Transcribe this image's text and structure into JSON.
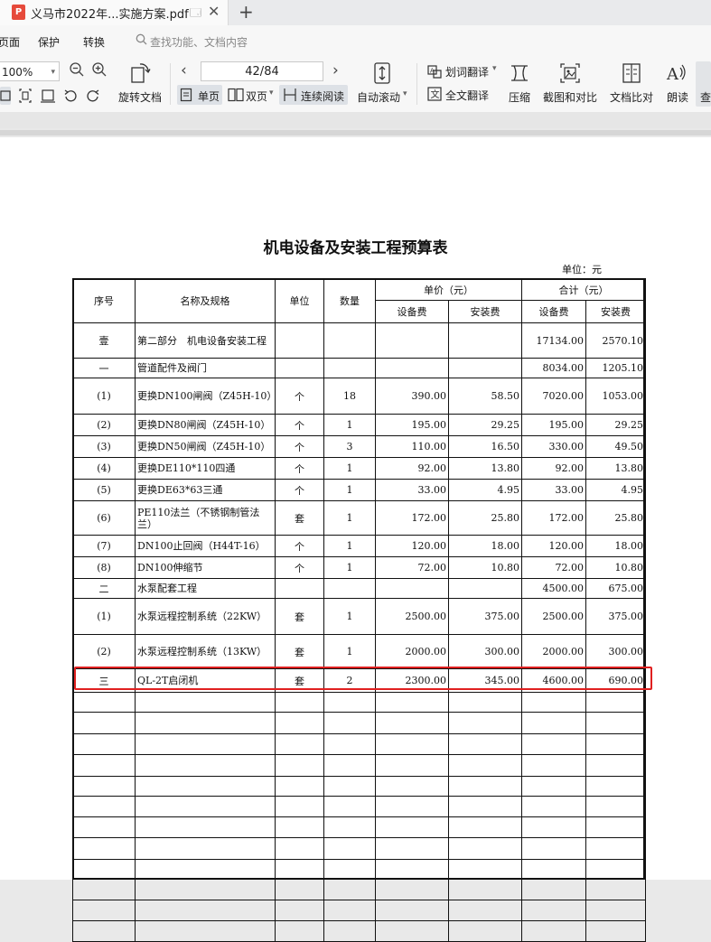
{
  "tab": {
    "icon_glyph": "P",
    "title": "义马市2022年...实施方案.pdf",
    "pin_glyph": "🗔",
    "close_glyph": "✕",
    "new_tab_glyph": "+"
  },
  "menu": {
    "items": [
      "页面",
      "保护",
      "转换"
    ],
    "search_placeholder": "查找功能、文档内容"
  },
  "toolbar": {
    "zoom": "100%",
    "page_indicator": "42/84",
    "rotate_label": "旋转文档",
    "single_page_label": "单页",
    "double_page_label": "双页",
    "continuous_label": "连续阅读",
    "auto_scroll_label": "自动滚动",
    "word_translate_label": "划词翻译",
    "full_translate_label": "全文翻译",
    "compress_label": "压缩",
    "screenshot_compare_label": "截图和对比",
    "doc_compare_label": "文档比对",
    "read_aloud_label": "朗读",
    "more_label": "查"
  },
  "document": {
    "title": "机电设备及安装工程预算表",
    "unit_label": "单位：元",
    "headers": {
      "seq": "序号",
      "name": "名称及规格",
      "unit": "单位",
      "qty": "数量",
      "unit_price": "单价（元）",
      "total": "合计（元）",
      "equipment": "设备费",
      "install": "安装费"
    },
    "rows": [
      {
        "seq": "壹",
        "name": "第二部分　机电设备安装工程",
        "unit": "",
        "qty": "",
        "up_equip": "",
        "up_install": "",
        "tot_equip": "17134.00",
        "tot_install": "2570.10"
      },
      {
        "seq": "一",
        "name": "管道配件及阀门",
        "unit": "",
        "qty": "",
        "up_equip": "",
        "up_install": "",
        "tot_equip": "8034.00",
        "tot_install": "1205.10"
      },
      {
        "seq": "(1)",
        "name": "更换DN100闸阀（Z45H-10）",
        "unit": "个",
        "qty": "18",
        "up_equip": "390.00",
        "up_install": "58.50",
        "tot_equip": "7020.00",
        "tot_install": "1053.00"
      },
      {
        "seq": "(2)",
        "name": "更换DN80闸阀（Z45H-10）",
        "unit": "个",
        "qty": "1",
        "up_equip": "195.00",
        "up_install": "29.25",
        "tot_equip": "195.00",
        "tot_install": "29.25"
      },
      {
        "seq": "(3)",
        "name": "更换DN50闸阀（Z45H-10）",
        "unit": "个",
        "qty": "3",
        "up_equip": "110.00",
        "up_install": "16.50",
        "tot_equip": "330.00",
        "tot_install": "49.50"
      },
      {
        "seq": "(4)",
        "name": "更换DE110*110四通",
        "unit": "个",
        "qty": "1",
        "up_equip": "92.00",
        "up_install": "13.80",
        "tot_equip": "92.00",
        "tot_install": "13.80"
      },
      {
        "seq": "(5)",
        "name": "更换DE63*63三通",
        "unit": "个",
        "qty": "1",
        "up_equip": "33.00",
        "up_install": "4.95",
        "tot_equip": "33.00",
        "tot_install": "4.95"
      },
      {
        "seq": "(6)",
        "name": "PE110法兰（不锈钢制管法兰）",
        "unit": "套",
        "qty": "1",
        "up_equip": "172.00",
        "up_install": "25.80",
        "tot_equip": "172.00",
        "tot_install": "25.80"
      },
      {
        "seq": "(7)",
        "name": "DN100止回阀（H44T-16）",
        "unit": "个",
        "qty": "1",
        "up_equip": "120.00",
        "up_install": "18.00",
        "tot_equip": "120.00",
        "tot_install": "18.00"
      },
      {
        "seq": "(8)",
        "name": "DN100伸缩节",
        "unit": "个",
        "qty": "1",
        "up_equip": "72.00",
        "up_install": "10.80",
        "tot_equip": "72.00",
        "tot_install": "10.80"
      },
      {
        "seq": "二",
        "name": "水泵配套工程",
        "unit": "",
        "qty": "",
        "up_equip": "",
        "up_install": "",
        "tot_equip": "4500.00",
        "tot_install": "675.00"
      },
      {
        "seq": "(1)",
        "name": "水泵远程控制系统（22KW）",
        "unit": "套",
        "qty": "1",
        "up_equip": "2500.00",
        "up_install": "375.00",
        "tot_equip": "2500.00",
        "tot_install": "375.00"
      },
      {
        "seq": "(2)",
        "name": "水泵远程控制系统（13KW）",
        "unit": "套",
        "qty": "1",
        "up_equip": "2000.00",
        "up_install": "300.00",
        "tot_equip": "2000.00",
        "tot_install": "300.00"
      },
      {
        "seq": "三",
        "name": "QL-2T启闭机",
        "unit": "套",
        "qty": "2",
        "up_equip": "2300.00",
        "up_install": "345.00",
        "tot_equip": "4600.00",
        "tot_install": "690.00"
      }
    ]
  }
}
